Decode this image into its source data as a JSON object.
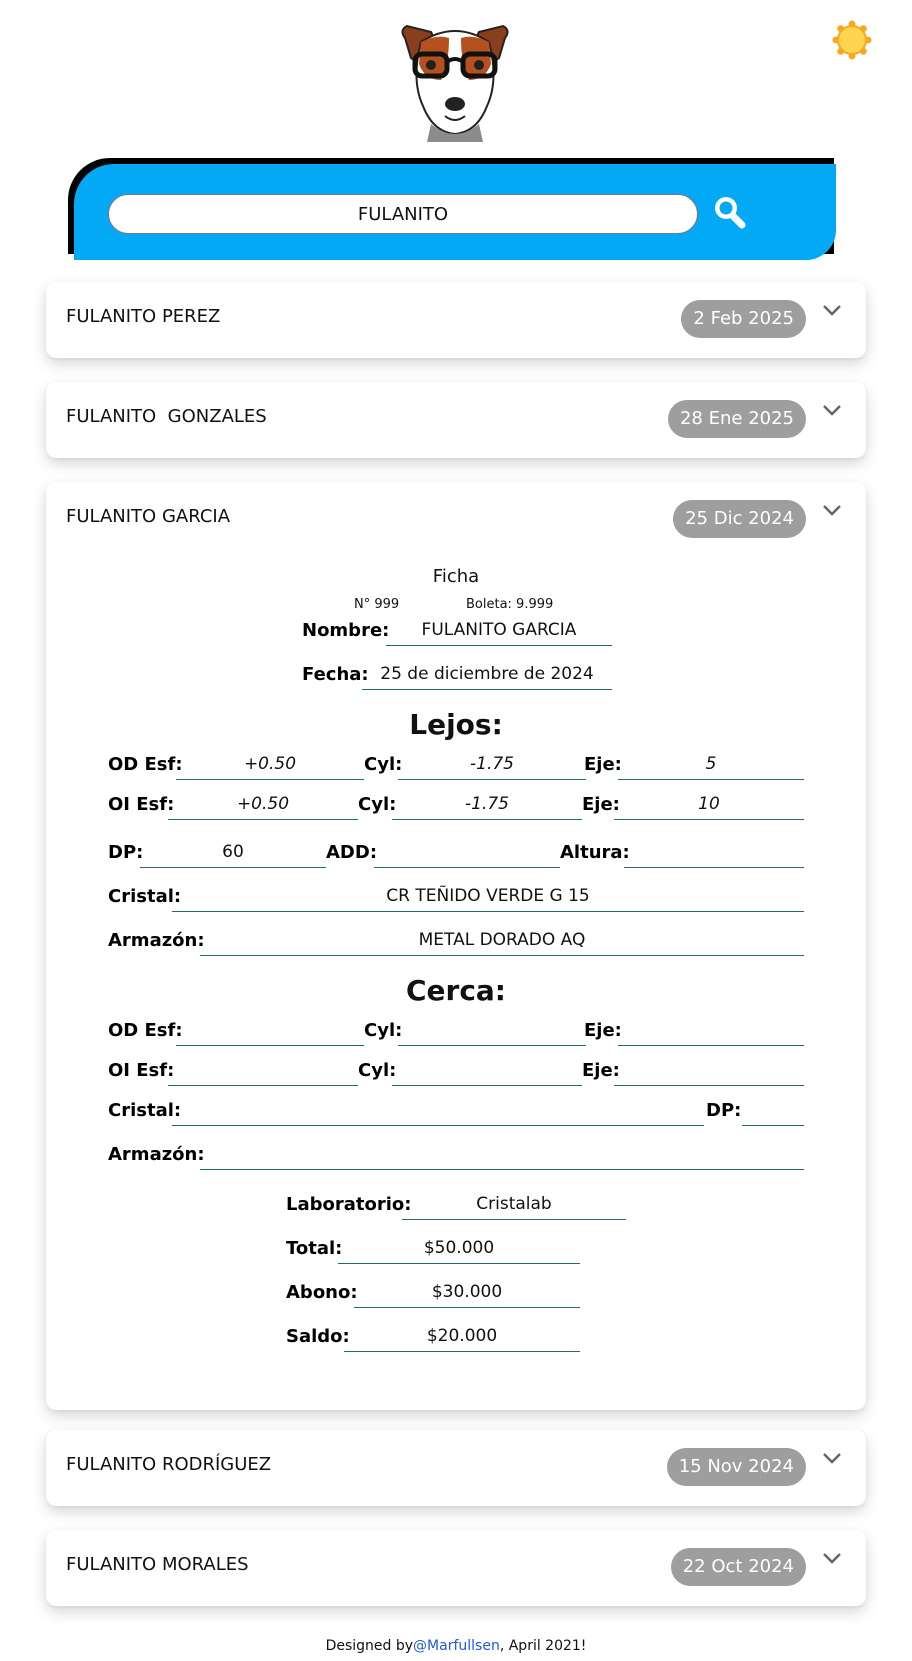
{
  "search": {
    "value": "FULANITO"
  },
  "records": [
    {
      "name": "FULANITO PEREZ",
      "date": "2 Feb 2025"
    },
    {
      "name": "FULANITO  GONZALES",
      "date": "28 Ene 2025"
    },
    {
      "name": "FULANITO GARCIA",
      "date": "25 Dic 2024"
    },
    {
      "name": "FULANITO RODRÍGUEZ",
      "date": "15 Nov 2024"
    },
    {
      "name": "FULANITO MORALES",
      "date": "22 Oct 2024"
    }
  ],
  "ficha": {
    "title": "Ficha",
    "number": "N° 999",
    "boleta": "Boleta: 9.999",
    "labels": {
      "nombre": "Nombre:",
      "fecha": "Fecha:",
      "od_esf": "OD Esf:",
      "oi_esf": "OI Esf:",
      "cyl": "Cyl:",
      "eje": "Eje:",
      "dp": "DP:",
      "add": "ADD:",
      "altura": "Altura:",
      "cristal": "Cristal:",
      "armazon": "Armazón:",
      "laboratorio": "Laboratorio:",
      "total": "Total:",
      "abono": "Abono:",
      "saldo": "Saldo:"
    },
    "nombre": "FULANITO GARCIA",
    "fecha": "25 de diciembre de 2024",
    "lejos": {
      "heading": "Lejos:",
      "od": {
        "esf": "+0.50",
        "cyl": "-1.75",
        "eje": "5"
      },
      "oi": {
        "esf": "+0.50",
        "cyl": "-1.75",
        "eje": "10"
      },
      "dp": "60",
      "add": "",
      "altura": "",
      "cristal": "CR TEÑIDO VERDE G 15",
      "armazon": "METAL DORADO AQ"
    },
    "cerca": {
      "heading": "Cerca:",
      "od": {
        "esf": "",
        "cyl": "",
        "eje": ""
      },
      "oi": {
        "esf": "",
        "cyl": "",
        "eje": ""
      },
      "cristal": "",
      "dp": "",
      "armazon": ""
    },
    "laboratorio": "Cristalab",
    "total": "$50.000",
    "abono": "$30.000",
    "saldo": "$20.000"
  },
  "footer": {
    "prefix": "Designed by",
    "author": "@Marfullsen",
    "suffix": ", April 2021!"
  },
  "colors": {
    "accent": "#03a9f4",
    "badge": "#9e9e9e",
    "sun": "#ffd54f",
    "link": "#1e5bd8",
    "underline": "#1f6a6a"
  }
}
